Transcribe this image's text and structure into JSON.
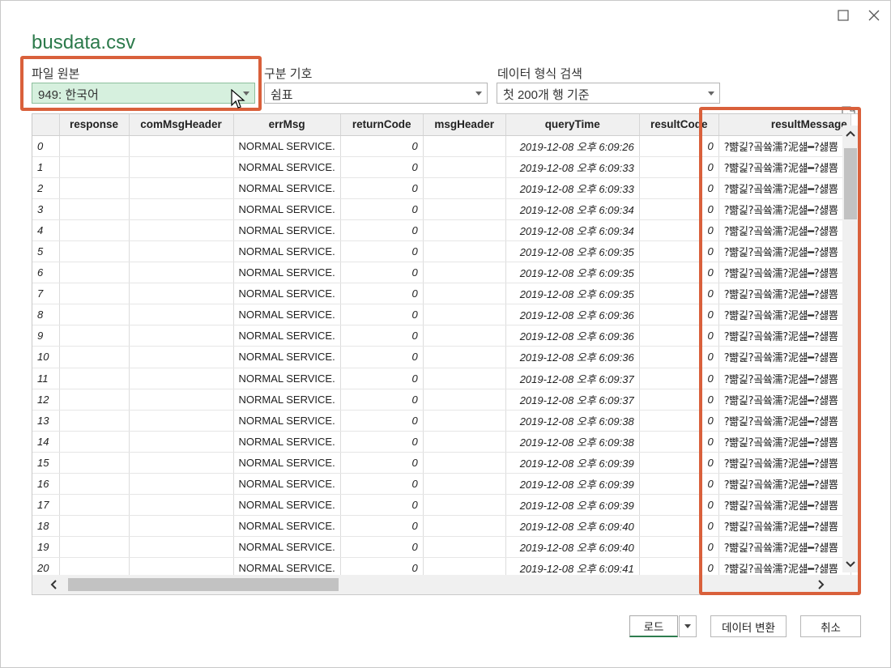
{
  "window": {
    "maximize_icon": "maximize-icon",
    "close_icon": "close-icon"
  },
  "file_title": "busdata.csv",
  "file_origin": {
    "label": "파일 원본",
    "value": "949: 한국어"
  },
  "delimiter": {
    "label": "구분 기호",
    "value": "쉼표"
  },
  "type_detection": {
    "label": "데이터 형식 검색",
    "value": "첫 200개 행 기준"
  },
  "table": {
    "columns": [
      "",
      "response",
      "comMsgHeader",
      "errMsg",
      "returnCode",
      "msgHeader",
      "queryTime",
      "resultCode",
      "resultMessage"
    ],
    "rows": [
      {
        "idx": "0",
        "errMsg": "NORMAL SERVICE.",
        "returnCode": "0",
        "queryTime": "2019-12-08 오후 6:09:26",
        "resultCode": "0",
        "resultMessage": "?뺢긽?곸쓬濡?泥섎━?섏뿀"
      },
      {
        "idx": "1",
        "errMsg": "NORMAL SERVICE.",
        "returnCode": "0",
        "queryTime": "2019-12-08 오후 6:09:33",
        "resultCode": "0",
        "resultMessage": "?뺢긽?곸쓬濡?泥섎━?섏뿀"
      },
      {
        "idx": "2",
        "errMsg": "NORMAL SERVICE.",
        "returnCode": "0",
        "queryTime": "2019-12-08 오후 6:09:33",
        "resultCode": "0",
        "resultMessage": "?뺢긽?곸쓬濡?泥섎━?섏뿀"
      },
      {
        "idx": "3",
        "errMsg": "NORMAL SERVICE.",
        "returnCode": "0",
        "queryTime": "2019-12-08 오후 6:09:34",
        "resultCode": "0",
        "resultMessage": "?뺢긽?곸쓬濡?泥섎━?섏뿀"
      },
      {
        "idx": "4",
        "errMsg": "NORMAL SERVICE.",
        "returnCode": "0",
        "queryTime": "2019-12-08 오후 6:09:34",
        "resultCode": "0",
        "resultMessage": "?뺢긽?곸쓬濡?泥섎━?섏뿀"
      },
      {
        "idx": "5",
        "errMsg": "NORMAL SERVICE.",
        "returnCode": "0",
        "queryTime": "2019-12-08 오후 6:09:35",
        "resultCode": "0",
        "resultMessage": "?뺢긽?곸쓬濡?泥섎━?섏뿀"
      },
      {
        "idx": "6",
        "errMsg": "NORMAL SERVICE.",
        "returnCode": "0",
        "queryTime": "2019-12-08 오후 6:09:35",
        "resultCode": "0",
        "resultMessage": "?뺢긽?곸쓬濡?泥섎━?섏뿀"
      },
      {
        "idx": "7",
        "errMsg": "NORMAL SERVICE.",
        "returnCode": "0",
        "queryTime": "2019-12-08 오후 6:09:35",
        "resultCode": "0",
        "resultMessage": "?뺢긽?곸쓬濡?泥섎━?섏뿀"
      },
      {
        "idx": "8",
        "errMsg": "NORMAL SERVICE.",
        "returnCode": "0",
        "queryTime": "2019-12-08 오후 6:09:36",
        "resultCode": "0",
        "resultMessage": "?뺢긽?곸쓬濡?泥섎━?섏뿀"
      },
      {
        "idx": "9",
        "errMsg": "NORMAL SERVICE.",
        "returnCode": "0",
        "queryTime": "2019-12-08 오후 6:09:36",
        "resultCode": "0",
        "resultMessage": "?뺢긽?곸쓬濡?泥섎━?섏뿀"
      },
      {
        "idx": "10",
        "errMsg": "NORMAL SERVICE.",
        "returnCode": "0",
        "queryTime": "2019-12-08 오후 6:09:36",
        "resultCode": "0",
        "resultMessage": "?뺢긽?곸쓬濡?泥섎━?섏뿀"
      },
      {
        "idx": "11",
        "errMsg": "NORMAL SERVICE.",
        "returnCode": "0",
        "queryTime": "2019-12-08 오후 6:09:37",
        "resultCode": "0",
        "resultMessage": "?뺢긽?곸쓬濡?泥섎━?섏뿀"
      },
      {
        "idx": "12",
        "errMsg": "NORMAL SERVICE.",
        "returnCode": "0",
        "queryTime": "2019-12-08 오후 6:09:37",
        "resultCode": "0",
        "resultMessage": "?뺢긽?곸쓬濡?泥섎━?섏뿀"
      },
      {
        "idx": "13",
        "errMsg": "NORMAL SERVICE.",
        "returnCode": "0",
        "queryTime": "2019-12-08 오후 6:09:38",
        "resultCode": "0",
        "resultMessage": "?뺢긽?곸쓬濡?泥섎━?섏뿀"
      },
      {
        "idx": "14",
        "errMsg": "NORMAL SERVICE.",
        "returnCode": "0",
        "queryTime": "2019-12-08 오후 6:09:38",
        "resultCode": "0",
        "resultMessage": "?뺢긽?곸쓬濡?泥섎━?섏뿀"
      },
      {
        "idx": "15",
        "errMsg": "NORMAL SERVICE.",
        "returnCode": "0",
        "queryTime": "2019-12-08 오후 6:09:39",
        "resultCode": "0",
        "resultMessage": "?뺢긽?곸쓬濡?泥섎━?섏뿀"
      },
      {
        "idx": "16",
        "errMsg": "NORMAL SERVICE.",
        "returnCode": "0",
        "queryTime": "2019-12-08 오후 6:09:39",
        "resultCode": "0",
        "resultMessage": "?뺢긽?곸쓬濡?泥섎━?섏뿀"
      },
      {
        "idx": "17",
        "errMsg": "NORMAL SERVICE.",
        "returnCode": "0",
        "queryTime": "2019-12-08 오후 6:09:39",
        "resultCode": "0",
        "resultMessage": "?뺢긽?곸쓬濡?泥섎━?섏뿀"
      },
      {
        "idx": "18",
        "errMsg": "NORMAL SERVICE.",
        "returnCode": "0",
        "queryTime": "2019-12-08 오후 6:09:40",
        "resultCode": "0",
        "resultMessage": "?뺢긽?곸쓬濡?泥섎━?섏뿀"
      },
      {
        "idx": "19",
        "errMsg": "NORMAL SERVICE.",
        "returnCode": "0",
        "queryTime": "2019-12-08 오후 6:09:40",
        "resultCode": "0",
        "resultMessage": "?뺢긽?곸쓬濡?泥섎━?섏뿀"
      },
      {
        "idx": "20",
        "errMsg": "NORMAL SERVICE.",
        "returnCode": "0",
        "queryTime": "2019-12-08 오후 6:09:41",
        "resultCode": "0",
        "resultMessage": "?뺢긽?곸쓬濡?泥섎━?섏뿀"
      }
    ]
  },
  "buttons": {
    "load": "로드",
    "transform": "데이터 변환",
    "cancel": "취소"
  },
  "colors": {
    "accent": "#2c7a4b",
    "highlight": "#d9603b",
    "selected_bg": "#d6f0de"
  },
  "icons": {
    "refresh": "refresh-file-icon",
    "cursor": "mouse-cursor-icon"
  }
}
